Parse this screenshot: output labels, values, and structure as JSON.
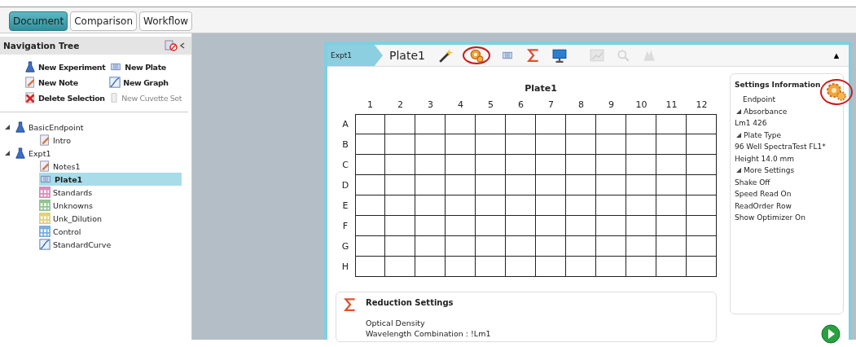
{
  "tabs": [
    {
      "label": "Document",
      "selected": true
    },
    {
      "label": "Comparison",
      "selected": false
    },
    {
      "label": "Workflow",
      "selected": false
    }
  ],
  "navigation": {
    "title": "Navigation Tree",
    "actions": [
      {
        "label": "New Experiment",
        "kind": "flask",
        "disabled": false
      },
      {
        "label": "New Plate",
        "kind": "plate",
        "disabled": false
      },
      {
        "label": "New Note",
        "kind": "note",
        "disabled": false
      },
      {
        "label": "New Graph",
        "kind": "graph",
        "disabled": false
      },
      {
        "label": "Delete Selection",
        "kind": "delete",
        "disabled": false
      },
      {
        "label": "New Cuvette Set",
        "kind": "cuvette",
        "disabled": true
      }
    ],
    "tree": [
      {
        "label": "BasicEndpoint",
        "kind": "flask",
        "expanded": true,
        "selected": false,
        "children": [
          {
            "label": "Intro",
            "kind": "note",
            "selected": false
          }
        ]
      },
      {
        "label": "Expt1",
        "kind": "flask",
        "expanded": true,
        "selected": false,
        "children": [
          {
            "label": "Notes1",
            "kind": "note",
            "selected": false
          },
          {
            "label": "Plate1",
            "kind": "plate",
            "selected": true
          },
          {
            "label": "Standards",
            "kind": "group",
            "color": "#d98cb8",
            "selected": false
          },
          {
            "label": "Unknowns",
            "kind": "group",
            "color": "#8fc48f",
            "selected": false
          },
          {
            "label": "Unk_Dilution",
            "kind": "group",
            "color": "#e0d07a",
            "selected": false
          },
          {
            "label": "Control",
            "kind": "group",
            "color": "#7aaee0",
            "selected": false
          },
          {
            "label": "StandardCurve",
            "kind": "graph",
            "selected": false
          }
        ]
      }
    ]
  },
  "plate_window": {
    "breadcrumb": "Expt1",
    "title": "Plate1",
    "toolbar": [
      {
        "kind": "wand",
        "disabled": false,
        "highlighted": false
      },
      {
        "kind": "settings",
        "disabled": false,
        "highlighted": true
      },
      {
        "kind": "plate",
        "disabled": false,
        "highlighted": false
      },
      {
        "kind": "sigma",
        "disabled": false,
        "highlighted": false
      },
      {
        "kind": "monitor",
        "disabled": false,
        "highlighted": false
      },
      {
        "kind": "chart",
        "disabled": true,
        "highlighted": false
      },
      {
        "kind": "zoom",
        "disabled": true,
        "highlighted": false
      },
      {
        "kind": "mask",
        "disabled": true,
        "highlighted": false
      }
    ],
    "collapse": "▲",
    "plate": {
      "title": "Plate1",
      "columns": [
        "1",
        "2",
        "3",
        "4",
        "5",
        "6",
        "7",
        "8",
        "9",
        "10",
        "11",
        "12"
      ],
      "rows": [
        "A",
        "B",
        "C",
        "D",
        "E",
        "F",
        "G",
        "H"
      ]
    },
    "reduction": {
      "title": "Reduction Settings",
      "lines": [
        "Optical Density",
        "Wavelength Combination : !Lm1"
      ]
    },
    "settings": {
      "title": "Settings Information",
      "highlighted": true,
      "items": [
        {
          "kind": "indented",
          "text": "Endpoint"
        },
        {
          "kind": "section",
          "text": "Absorbance"
        },
        {
          "kind": "line",
          "text": "Lm1    426"
        },
        {
          "kind": "section",
          "text": "Plate Type"
        },
        {
          "kind": "line",
          "text": "96 Well SpectraTest FL1*"
        },
        {
          "kind": "line",
          "text": "Height  14.0 mm"
        },
        {
          "kind": "section",
          "text": "More Settings"
        },
        {
          "kind": "line",
          "text": "Shake  Off"
        },
        {
          "kind": "line",
          "text": "Speed Read  On"
        },
        {
          "kind": "line",
          "text": "ReadOrder  Row"
        },
        {
          "kind": "line",
          "text": "Show Optimizer  On"
        }
      ]
    }
  }
}
